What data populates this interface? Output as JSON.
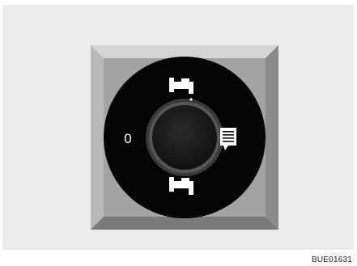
{
  "figure": {
    "caption": "BUE01631",
    "switch_positions": [
      {
        "id": "off",
        "symbol": "0"
      },
      {
        "id": "washer-top",
        "icon": "washer-tap-icon"
      },
      {
        "id": "rear-window",
        "icon": "rear-window-icon"
      },
      {
        "id": "washer-bottom",
        "icon": "washer-tap-icon"
      }
    ]
  }
}
